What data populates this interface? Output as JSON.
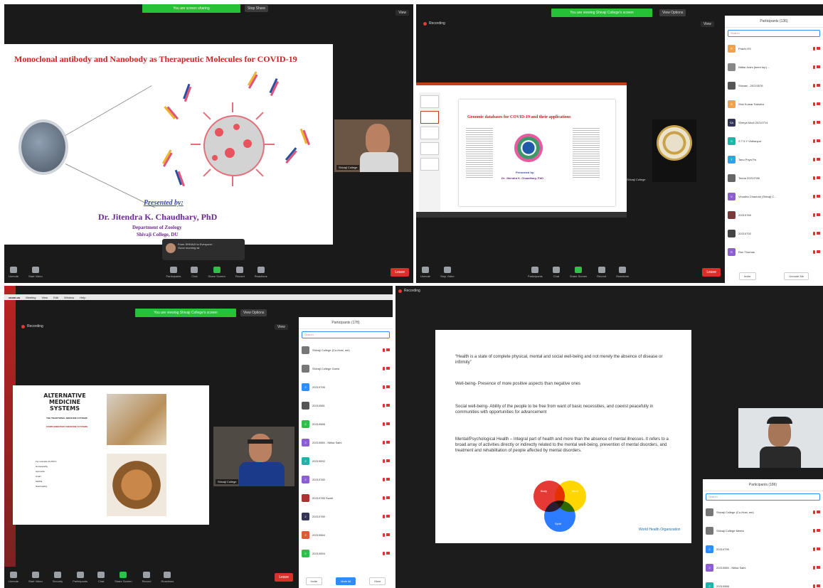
{
  "q1": {
    "share_bar": "You are screen sharing",
    "stop_share": "Stop Share",
    "view": "View",
    "slide": {
      "title": "Monoclonal antibody and Nanobody as Therapeutic Molecules for COVID-19",
      "presented_by": "Presented by:",
      "presenter": "Dr. Jitendra K. Chaudhary, PhD",
      "department": "Department of Zoology",
      "college": "Shivaji College, DU"
    },
    "notification": {
      "line1": "From SHIVAJI to Everyone:",
      "line2": "Good morning sir"
    },
    "video_name": "Shivaji College",
    "toolbar": [
      "Unmute",
      "Start Video",
      "Participants",
      "Chat",
      "Share Screen",
      "Record",
      "Reactions"
    ],
    "leave": "Leave"
  },
  "q2": {
    "share_bar": "You are viewing Shivaji College's screen",
    "view_options": "View Options",
    "recording": "Recording",
    "view": "View",
    "slide": {
      "title": "Genomic databases for COVID-19 and their applications",
      "presented_by": "Presented by:",
      "presenter": "Dr. Jitendra K. Chaudhary, PhD"
    },
    "tile_label": "Shivaji College",
    "panel": {
      "title": "Participants (136)",
      "search": "Search",
      "participants": [
        {
          "initial": "P",
          "name": "Prachi ES",
          "color": "#f0a34a"
        },
        {
          "initial": "",
          "name": "Nitika Joshi (been top) ...",
          "color": "#888"
        },
        {
          "initial": "",
          "name": "Shivani - 20210578",
          "color": "#555"
        },
        {
          "initial": "S",
          "name": "Shiv Kumar Sahotra",
          "color": "#f0a34a"
        },
        {
          "initial": "SA",
          "name": "Shreya Modi  20210714",
          "color": "#335"
        },
        {
          "initial": "S",
          "name": "S T 6 Y Vidhanpur",
          "color": "#1fb4a8"
        },
        {
          "initial": "T",
          "name": "Tanu Priya Pa",
          "color": "#2aa6e0"
        },
        {
          "initial": "",
          "name": "Teena 20210788",
          "color": "#666"
        },
        {
          "initial": "V",
          "name": "Vinodha Chauhan (Shivaji C...",
          "color": "#8b5fd1"
        },
        {
          "initial": "",
          "name": "20210789",
          "color": "#7a3a3a"
        },
        {
          "initial": "",
          "name": "20210792",
          "color": "#444"
        },
        {
          "initial": "R",
          "name": "Run Thomas",
          "color": "#8b5fd1"
        }
      ],
      "invite": "Invite",
      "unmute_me": "Unmute Me"
    },
    "toolbar": [
      "Unmute",
      "Stop Video",
      "Participants",
      "Chat",
      "Share Screen",
      "Record",
      "Reactions"
    ],
    "leave": "Leave"
  },
  "q3": {
    "mac_menu": [
      "zoom.us",
      "Meeting",
      "View",
      "Edit",
      "Window",
      "Help"
    ],
    "share_bar": "You are viewing Shivaji College's screen",
    "view_options": "View Options",
    "recording": "Recording",
    "view": "View",
    "slide": {
      "title": "ALTERNATIVE MEDICINE SYSTEMS",
      "sub1": "THE TRADITIONAL MEDICINE SYSTEMS",
      "sub2": "COMPLEMENTARY MEDICINE SYSTEMS",
      "list_head": "For example (FUSSY)",
      "list": [
        "Homeopathy",
        "Ayurveda",
        "Unani",
        "Siddha",
        "Naturopathy"
      ]
    },
    "tile_label": "Shivaji College",
    "panel": {
      "title": "Participants (178)",
      "search": "Search",
      "participants": [
        {
          "initial": "",
          "name": "Shivaji College (Co-Host, me)",
          "color": "#777"
        },
        {
          "initial": "",
          "name": "Shivaji College Guest",
          "color": "#777"
        },
        {
          "initial": "2",
          "name": "20210795",
          "color": "#2d8cff"
        },
        {
          "initial": "",
          "name": "20210581",
          "color": "#555"
        },
        {
          "initial": "2",
          "name": "20210588",
          "color": "#2fbf4a"
        },
        {
          "initial": "2",
          "name": "20210580 - Nitika Saini",
          "color": "#8b5fd1"
        },
        {
          "initial": "2",
          "name": "20210592",
          "color": "#1fb4a8"
        },
        {
          "initial": "2",
          "name": "20210780",
          "color": "#8b5fd1"
        },
        {
          "initial": "",
          "name": "20210785 Swati",
          "color": "#a33"
        },
        {
          "initial": "2",
          "name": "20210789",
          "color": "#335"
        },
        {
          "initial": "2",
          "name": "20210584",
          "color": "#e05a3a"
        },
        {
          "initial": "2",
          "name": "20210594",
          "color": "#2fbf4a"
        }
      ],
      "invite": "Invite",
      "mute_all": "Mute All",
      "more": "More"
    },
    "toolbar": [
      "Unmute",
      "Start Video",
      "Security",
      "Participants",
      "Chat",
      "Share Screen",
      "Record",
      "Reactions"
    ],
    "leave": "Leave"
  },
  "q4": {
    "recording": "Recording",
    "slide": {
      "p1": "“Health is a state of complete physical, mental and social well-being and not merely the absence of disease or infirmity”",
      "p2": "Well-being- Presence of more positive aspects than negative ones",
      "p3": "Social well-being- Ability of the people to be free from want of basic necessities, and coexist peacefully in communities with opportunities for advancement",
      "p4": "Mental/Psychological Health – Integral part of health and more than the absence of mental illnesses. It refers to a broad array of activities directly or indirectly related to the mental well-being, prevention of mental disorders, and treatment and rehabilitation of people affected by mental disorders.",
      "venn_center": "Health",
      "venn_a": "Body",
      "venn_b": "Mind",
      "venn_c": "Spirit",
      "who": "World Health Organization"
    },
    "panel": {
      "title": "Participants (186)",
      "search": "Search",
      "participants": [
        {
          "initial": "",
          "name": "Shivaji College (Co-Host, me)",
          "color": "#777"
        },
        {
          "initial": "",
          "name": "Shivaji College Meeta",
          "color": "#777"
        },
        {
          "initial": "2",
          "name": "20210795",
          "color": "#2d8cff"
        },
        {
          "initial": "2",
          "name": "20210580 - Nitika Saini",
          "color": "#8b5fd1"
        },
        {
          "initial": "2",
          "name": "20210588",
          "color": "#1fb4a8"
        }
      ]
    }
  }
}
